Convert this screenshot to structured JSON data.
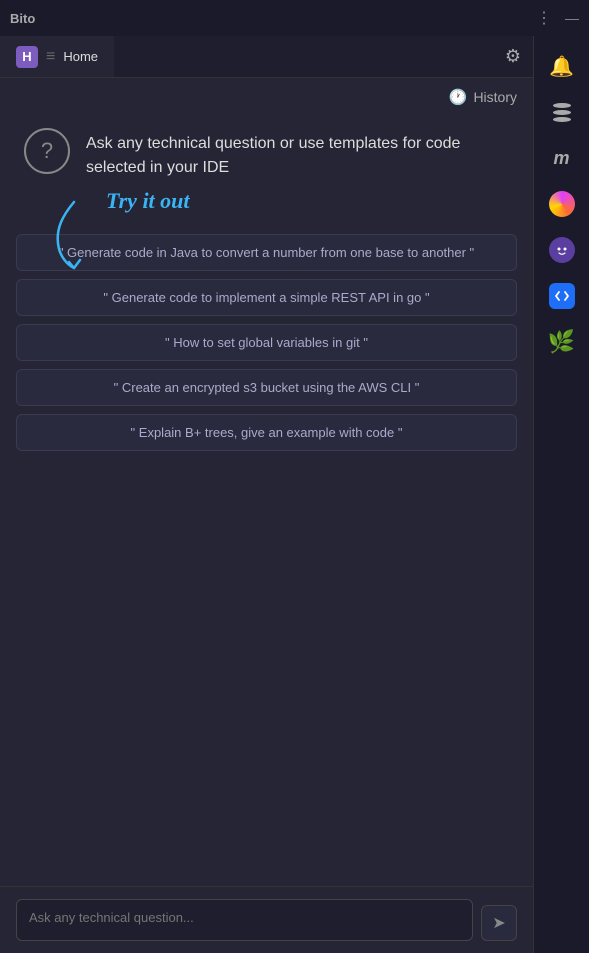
{
  "titleBar": {
    "title": "Bito",
    "controls": {
      "menu": "⋮",
      "minimize": "—"
    }
  },
  "tabBar": {
    "homeIconLabel": "H",
    "separator": "≡",
    "tabLabel": "Home",
    "gearIcon": "⚙"
  },
  "history": {
    "label": "History",
    "icon": "🕐"
  },
  "hero": {
    "questionIcon": "?",
    "text": "Ask any technical question or use templates for code selected in your IDE"
  },
  "trySection": {
    "label": "Try it out"
  },
  "suggestions": [
    "\" Generate code in Java to convert a number from one base to another \"",
    "\" Generate code to implement a simple REST API in go \"",
    "\" How to set global variables in git \"",
    "\" Create an encrypted s3 bucket using the AWS CLI \"",
    "\" Explain B+ trees, give an example with code \""
  ],
  "inputArea": {
    "placeholder": "Ask any technical question...",
    "sendIcon": "➤"
  },
  "rightSidebar": {
    "icons": [
      {
        "name": "notification-icon",
        "symbol": "🔔"
      },
      {
        "name": "database-icon",
        "symbol": "db"
      },
      {
        "name": "m-icon",
        "symbol": "m"
      },
      {
        "name": "gradient-icon",
        "symbol": "◉"
      },
      {
        "name": "copilot-icon",
        "symbol": "●"
      },
      {
        "name": "diamond-icon",
        "symbol": "◆"
      },
      {
        "name": "leaf-icon",
        "symbol": "🌿"
      }
    ]
  }
}
